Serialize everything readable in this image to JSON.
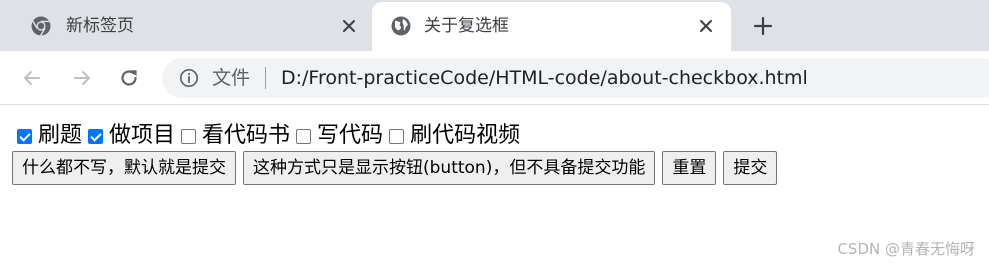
{
  "browser": {
    "tabs": [
      {
        "title": "新标签页",
        "favicon": "chrome-icon",
        "active": false
      },
      {
        "title": "关于复选框",
        "favicon": "globe-icon",
        "active": true
      }
    ],
    "address_bar": {
      "origin_label": "文件",
      "url": "D:/Front-practiceCode/HTML-code/about-checkbox.html"
    }
  },
  "page": {
    "checkboxes": [
      {
        "label": "刷题",
        "checked": true
      },
      {
        "label": "做项目",
        "checked": true
      },
      {
        "label": "看代码书",
        "checked": false
      },
      {
        "label": "写代码",
        "checked": false
      },
      {
        "label": "刷代码视频",
        "checked": false
      }
    ],
    "buttons": [
      {
        "label": "什么都不写，默认就是提交"
      },
      {
        "label": "这种方式只是显示按钮(button)，但不具备提交功能"
      },
      {
        "label": "重置"
      },
      {
        "label": "提交"
      }
    ]
  },
  "watermark": "CSDN @青春无悔呀",
  "colors": {
    "tabstrip": "#dee1e6",
    "checkbox_checked": "#0075ff",
    "omnibox": "#f1f3f4"
  }
}
